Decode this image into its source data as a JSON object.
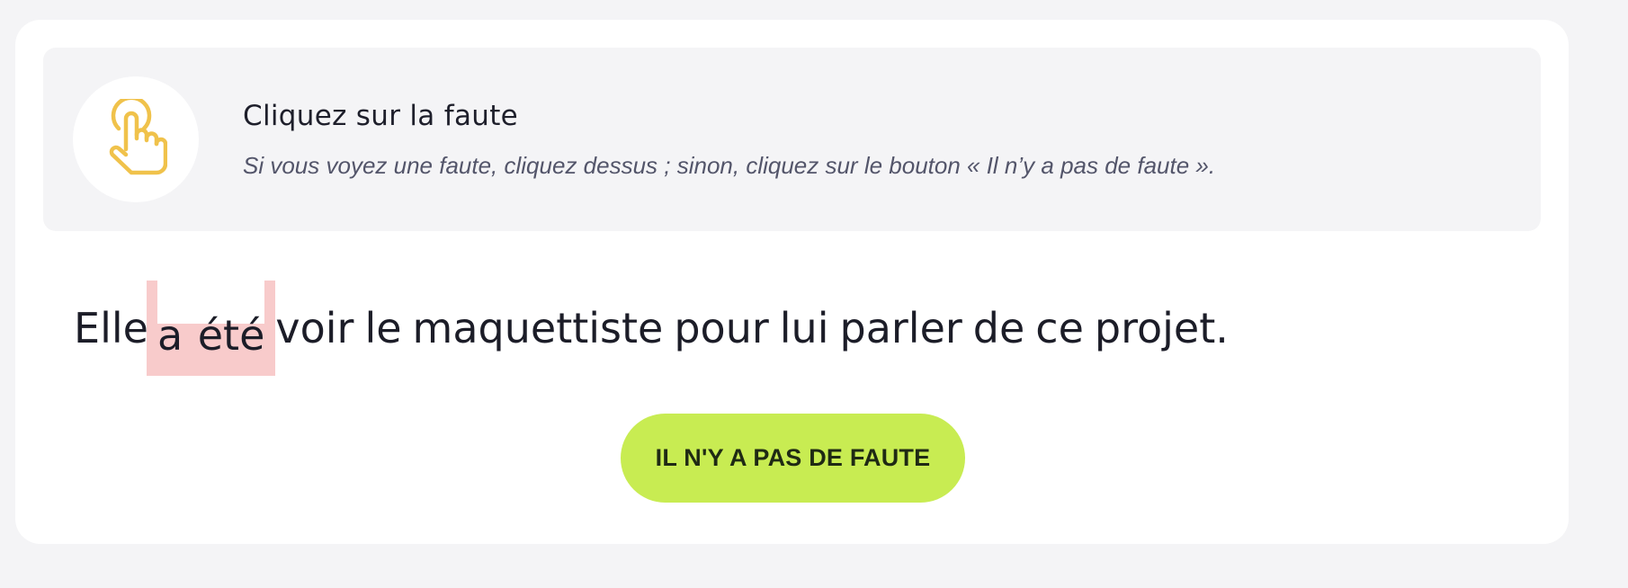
{
  "instruction": {
    "icon": "tap-hand-icon",
    "icon_color": "#f0c24b",
    "title": "Cliquez sur la faute",
    "text": "Si vous voyez une faute, cliquez dessus ; sinon, cliquez sur le bouton « Il n’y a pas de faute »."
  },
  "sentence": {
    "words": [
      "Elle",
      "a été",
      "voir",
      "le",
      "maquettiste",
      "pour",
      "lui",
      "parler",
      "de",
      "ce",
      "projet."
    ],
    "highlighted_word": "a été",
    "highlight_color": "#f8cbcb"
  },
  "no_error_button": {
    "label": "IL N'Y A PAS DE FAUTE",
    "color": "#c8ec52"
  }
}
